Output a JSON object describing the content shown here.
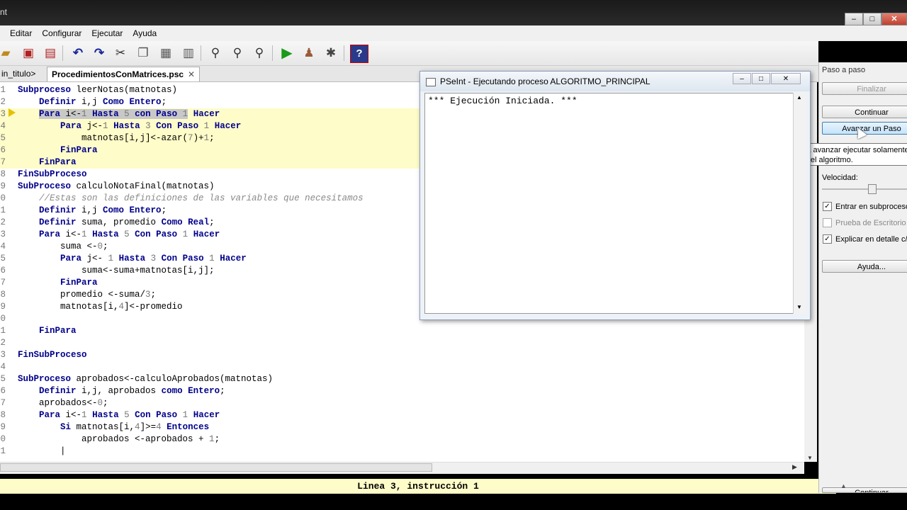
{
  "window": {
    "title": "nt"
  },
  "menu": [
    "Editar",
    "Configurar",
    "Ejecutar",
    "Ayuda"
  ],
  "tabs": [
    {
      "label": "in_titulo>"
    },
    {
      "label": "ProcedimientosConMatrices.psc"
    }
  ],
  "editor": {
    "lines": [
      {
        "n": "1",
        "html": "<span class=\"kw\">Subproceso</span> leerNotas(matnotas)"
      },
      {
        "n": "2",
        "html": "    <span class=\"kw\">Definir</span> i,j <span class=\"kw\">Como Entero</span>;"
      },
      {
        "n": "3",
        "html": "    <span class=\"sel\"><span class=\"kw\">Para</span> i&lt;-<span class=\"num\">1</span> <span class=\"kw\">Hasta</span> <span class=\"num\">5</span> <span class=\"kw\">con Paso</span> <span class=\"num\">1</span></span> <span class=\"kw\">Hacer</span>",
        "hl": true
      },
      {
        "n": "4",
        "html": "        <span class=\"kw\">Para</span> j&lt;-<span class=\"num\">1</span> <span class=\"kw\">Hasta</span> <span class=\"num\">3</span> <span class=\"kw\">Con Paso</span> <span class=\"num\">1</span> <span class=\"kw\">Hacer</span>",
        "hl": true
      },
      {
        "n": "5",
        "html": "            matnotas[i,j]&lt;-azar(<span class=\"num\">7</span>)+<span class=\"num\">1</span>;",
        "hl": true
      },
      {
        "n": "6",
        "html": "        <span class=\"kw\">FinPara</span>",
        "hl": true
      },
      {
        "n": "7",
        "html": "    <span class=\"kw\">FinPara</span>",
        "hl": true
      },
      {
        "n": "8",
        "html": "<span class=\"kw\">FinSubProceso</span>"
      },
      {
        "n": "9",
        "html": "<span class=\"kw\">SubProceso</span> calculoNotaFinal(matnotas)"
      },
      {
        "n": "0",
        "html": "    <span class=\"cmt\">//Estas son las definiciones de las variables que necesitamos</span>"
      },
      {
        "n": "1",
        "html": "    <span class=\"kw\">Definir</span> i,j <span class=\"kw\">Como Entero</span>;"
      },
      {
        "n": "2",
        "html": "    <span class=\"kw\">Definir</span> suma, promedio <span class=\"kw\">Como Real</span>;"
      },
      {
        "n": "3",
        "html": "    <span class=\"kw\">Para</span> i&lt;-<span class=\"num\">1</span> <span class=\"kw\">Hasta</span> <span class=\"num\">5</span> <span class=\"kw\">Con Paso</span> <span class=\"num\">1</span> <span class=\"kw\">Hacer</span>"
      },
      {
        "n": "4",
        "html": "        suma &lt;-<span class=\"num\">0</span>;"
      },
      {
        "n": "5",
        "html": "        <span class=\"kw\">Para</span> j&lt;- <span class=\"num\">1</span> <span class=\"kw\">Hasta</span> <span class=\"num\">3</span> <span class=\"kw\">Con Paso</span> <span class=\"num\">1</span> <span class=\"kw\">Hacer</span>"
      },
      {
        "n": "6",
        "html": "            suma&lt;-suma+matnotas[i,j];"
      },
      {
        "n": "7",
        "html": "        <span class=\"kw\">FinPara</span>"
      },
      {
        "n": "8",
        "html": "        promedio &lt;-suma/<span class=\"num\">3</span>;"
      },
      {
        "n": "9",
        "html": "        matnotas[i,<span class=\"num\">4</span>]&lt;-promedio"
      },
      {
        "n": "0",
        "html": ""
      },
      {
        "n": "1",
        "html": "    <span class=\"kw\">FinPara</span>"
      },
      {
        "n": "2",
        "html": ""
      },
      {
        "n": "3",
        "html": "<span class=\"kw\">FinSubProceso</span>"
      },
      {
        "n": "4",
        "html": ""
      },
      {
        "n": "5",
        "html": "<span class=\"kw\">SubProceso</span> aprobados&lt;-calculoAprobados(matnotas)"
      },
      {
        "n": "6",
        "html": "    <span class=\"kw\">Definir</span> i,j, aprobados <span class=\"kw\">como Entero</span>;"
      },
      {
        "n": "7",
        "html": "    aprobados&lt;-<span class=\"num\">0</span>;"
      },
      {
        "n": "8",
        "html": "    <span class=\"kw\">Para</span> i&lt;-<span class=\"num\">1</span> <span class=\"kw\">Hasta</span> <span class=\"num\">5</span> <span class=\"kw\">Con Paso</span> <span class=\"num\">1</span> <span class=\"kw\">Hacer</span>"
      },
      {
        "n": "9",
        "html": "        <span class=\"kw\">Si</span> matnotas[i,<span class=\"num\">4</span>]&gt;=<span class=\"num\">4</span> <span class=\"kw\">Entonces</span>"
      },
      {
        "n": "0",
        "html": "            aprobados &lt;-aprobados + <span class=\"num\">1</span>;"
      },
      {
        "n": "1",
        "html": "        |"
      }
    ]
  },
  "status": {
    "text": "Linea 3, instrucción 1"
  },
  "panel": {
    "title": "Paso a paso",
    "finalizar": "Finalizar",
    "continuar": "Continuar",
    "avanzar": "Avanzar un Paso",
    "velocidad": "Velocidad:",
    "entrar": "Entrar en subprocesos",
    "prueba": "Prueba de Escritorio",
    "explicar": "Explicar en detalle c/paso",
    "ayuda": "Ayuda...",
    "bottom_button": "Continuar",
    "speed_level": 0.6
  },
  "tooltip": {
    "line1": "Utilice este botón para avanzar ejecutar solamente",
    "line2": "siguiente instrucción del algoritmo."
  },
  "exec": {
    "title": "PSeInt - Ejecutando proceso ALGORITMO_PRINCIPAL",
    "output": "*** Ejecución Iniciada. ***"
  },
  "toolbar_icons": [
    "open-icon",
    "save-icon",
    "save-as-icon",
    "undo-icon",
    "redo-icon",
    "cut-icon",
    "copy-icon",
    "paste-icon",
    "edit-icon",
    "find-icon",
    "find-next-icon",
    "replace-icon",
    "run-icon",
    "step-icon",
    "debug-icon",
    "help-icon"
  ]
}
